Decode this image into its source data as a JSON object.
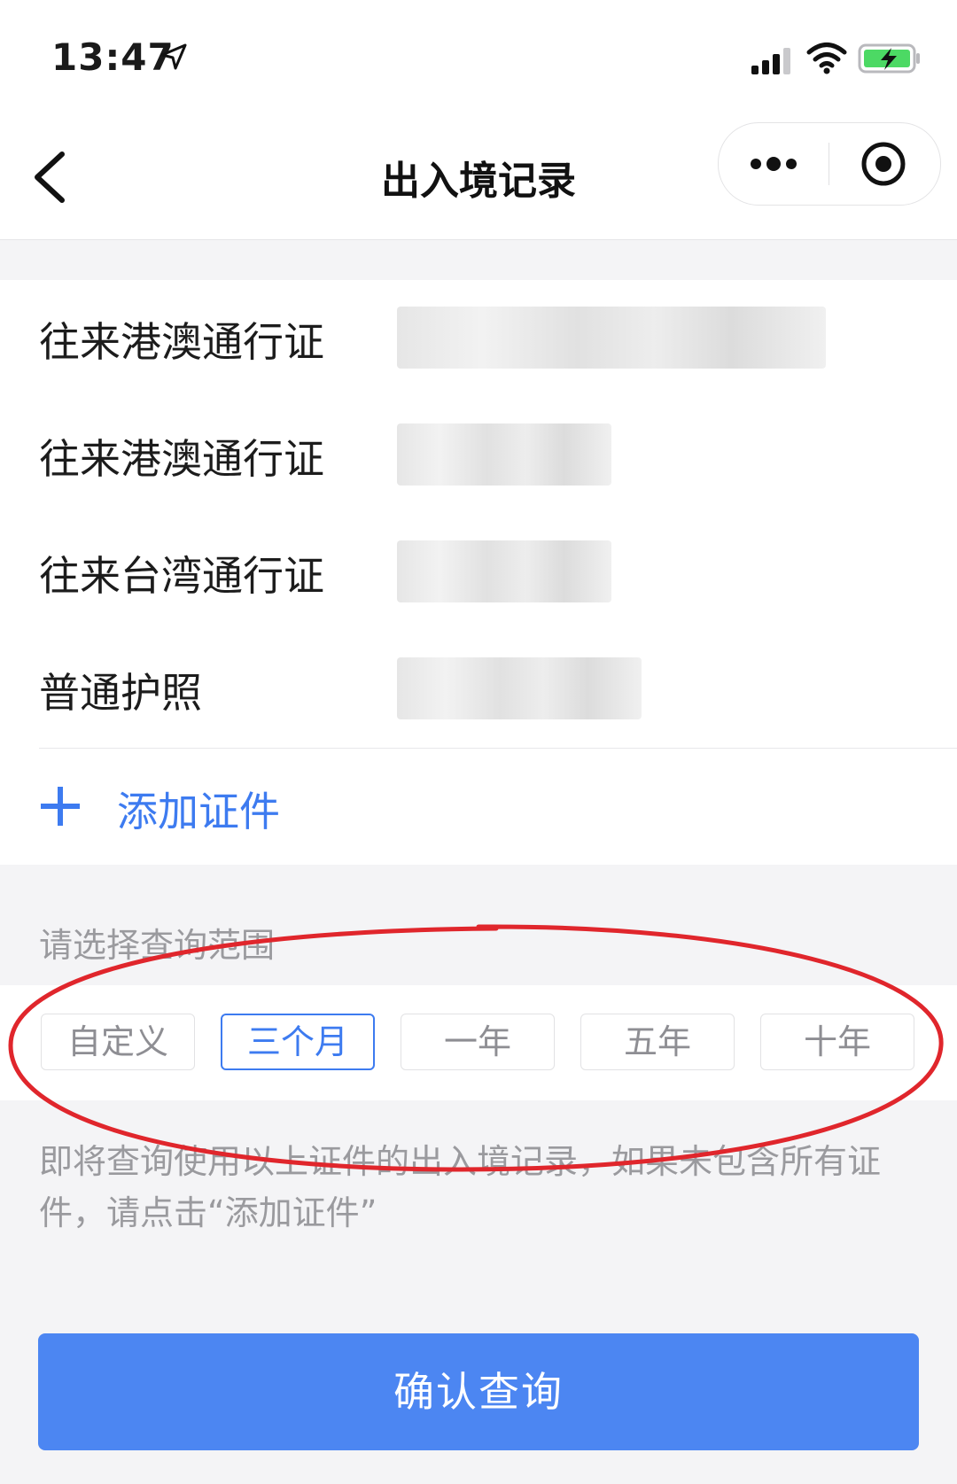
{
  "status_bar": {
    "time": "13:47",
    "icons": [
      "location-arrow-icon",
      "signal-icon",
      "wifi-icon",
      "battery-charging-icon"
    ]
  },
  "nav": {
    "title": "出入境记录",
    "back_icon": "chevron-left-icon",
    "more_icon": "more-dots-icon",
    "close_icon": "target-circle-icon"
  },
  "documents": [
    {
      "label": "往来港澳通行证"
    },
    {
      "label": "往来港澳通行证"
    },
    {
      "label": "往来台湾通行证"
    },
    {
      "label": "普通护照"
    }
  ],
  "add_document": {
    "label": "添加证件",
    "icon": "plus-icon"
  },
  "range": {
    "title": "请选择查询范围",
    "options": [
      "自定义",
      "三个月",
      "一年",
      "五年",
      "十年"
    ],
    "selected": "三个月"
  },
  "notice": "即将查询使用以上证件的出入境记录，如果未包含所有证件，请点击“添加证件”",
  "confirm_label": "确认查询",
  "colors": {
    "accent": "#3d7bf0",
    "button": "#4c86f2",
    "annotation": "#e0262c"
  }
}
